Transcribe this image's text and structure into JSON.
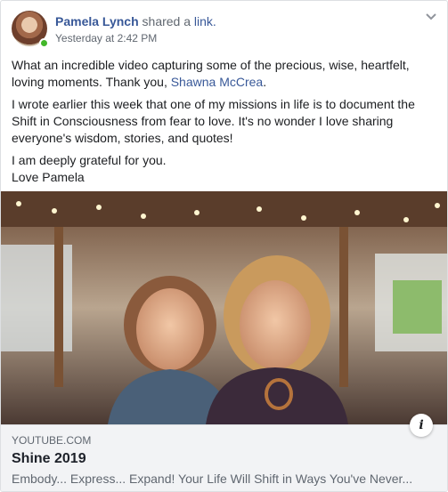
{
  "post": {
    "author": "Pamela Lynch",
    "action_text": "shared a",
    "action_link": "link.",
    "timestamp": "Yesterday at 2:42 PM",
    "paragraph1_before": "What an incredible video capturing some of the precious, wise, heartfelt, loving moments. Thank you, ",
    "paragraph1_mention": "Shawna McCrea",
    "paragraph1_after": ".",
    "paragraph2": "I wrote earlier this week that one of my missions in life is to document the Shift in Consciousness from fear to love. It's no wonder I love sharing everyone's wisdom, stories, and quotes!",
    "paragraph3_line1": "I am deeply grateful for you.",
    "paragraph3_line2": "Love Pamela"
  },
  "link_preview": {
    "domain": "YOUTUBE.COM",
    "title": "Shine 2019",
    "description": "Embody... Express... Expand! Your Life Will Shift in Ways You've Never...",
    "info_glyph": "i"
  },
  "icons": {
    "avatar": "avatar",
    "presence": "online-dot",
    "privacy": "globe-icon",
    "options": "chevron-down-icon",
    "info": "info-icon"
  },
  "colors": {
    "link": "#385898",
    "secondary_text": "#606770",
    "presence_green": "#42b72a",
    "link_box_bg": "#f2f3f5"
  }
}
